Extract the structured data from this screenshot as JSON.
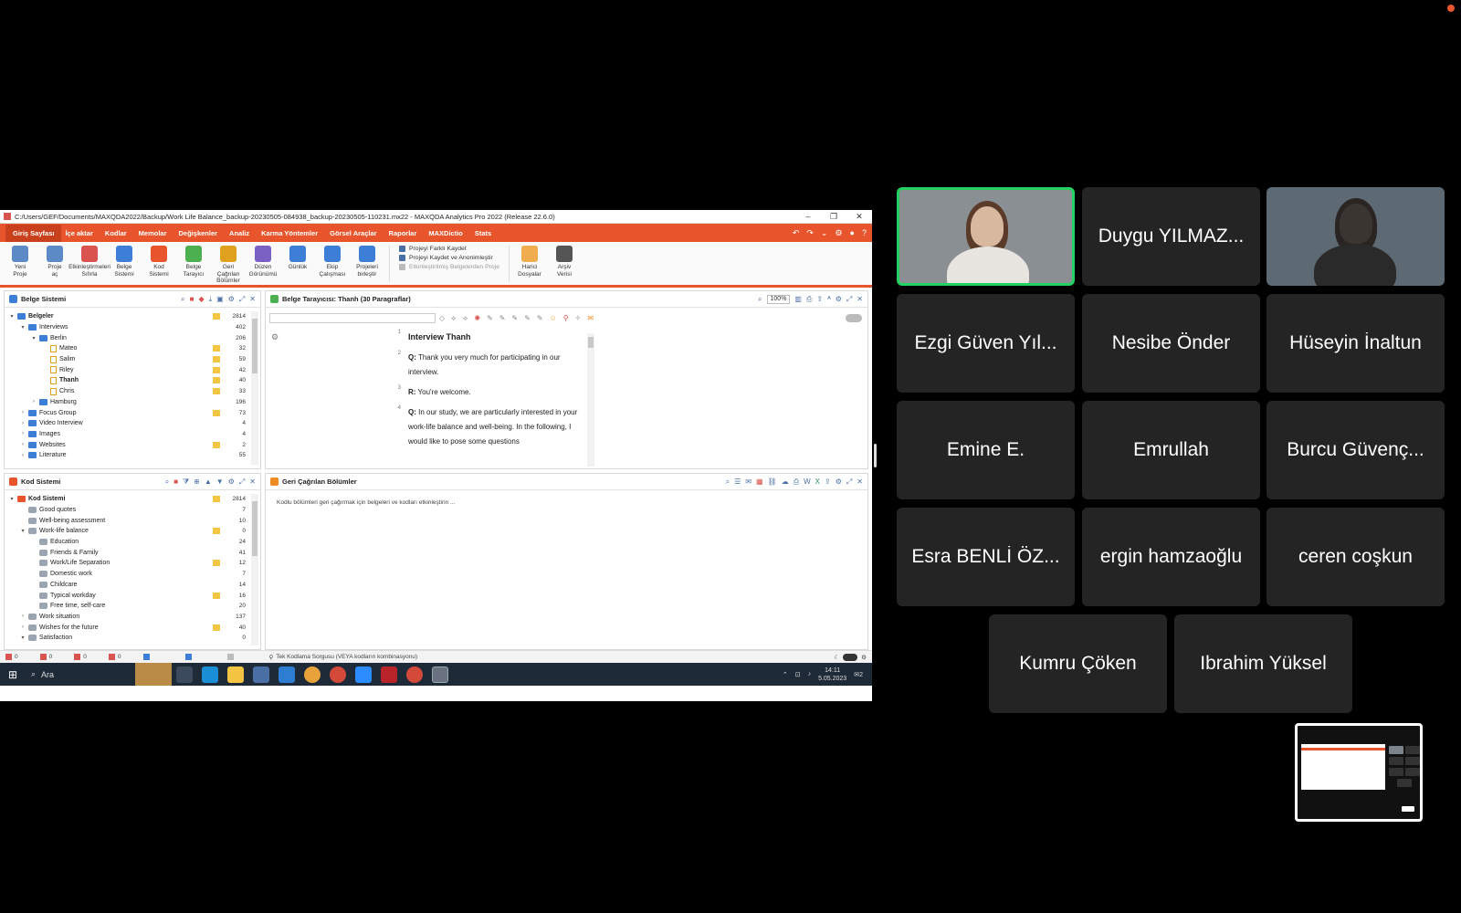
{
  "window": {
    "title": "C:/Users/GEF/Documents/MAXQDA2022/Backup/Work Life Balance_backup-20230505-084938_backup-20230505-110231.mx22 - MAXQDA Analytics Pro 2022 (Release 22.6.0)"
  },
  "menu": [
    "Giriş Sayfası",
    "İçe aktar",
    "Kodlar",
    "Memolar",
    "Değişkenler",
    "Analiz",
    "Karma Yöntemler",
    "Görsel Araçlar",
    "Raporlar",
    "MAXDictio",
    "Stats"
  ],
  "ribbon": {
    "buttons": [
      {
        "label": "Yeni\nProje",
        "color": "#5b8ac7"
      },
      {
        "label": "Proje\naç",
        "color": "#5b8ac7"
      },
      {
        "label": "Etkinleştirmeleri\nSıfırla",
        "color": "#d9534f"
      },
      {
        "label": "Belge\nSistemi",
        "color": "#3d7fd6"
      },
      {
        "label": "Kod\nSistemi",
        "color": "#e8552c"
      },
      {
        "label": "Belge\nTarayıcı",
        "color": "#4caf50"
      },
      {
        "label": "Geri Çağrılan\nBölümler",
        "color": "#e0a020"
      },
      {
        "label": "Düzen\nGörünümü",
        "color": "#7b61c4"
      },
      {
        "label": "Günlük",
        "color": "#3d7fd6"
      },
      {
        "label": "Ekip\nÇalışması",
        "color": "#3d7fd6"
      },
      {
        "label": "Projeleri\nbirleştir",
        "color": "#3d7fd6"
      }
    ],
    "list": [
      "Projeyi Farklı Kaydet",
      "Projeyi Kaydet ve Anonimleştir",
      "Etkinleştirilmiş Belgelerden Proje"
    ],
    "buttons2": [
      {
        "label": "Harici\nDosyalar",
        "color": "#f0ad4e"
      },
      {
        "label": "Arşiv\nVerisi",
        "color": "#555555"
      }
    ]
  },
  "document_system": {
    "title": "Belge Sistemi",
    "rows": [
      {
        "name": "Belgeler",
        "count": "2814",
        "level": 0,
        "type": "folder",
        "arrow": "▾",
        "bold": true
      },
      {
        "name": "Interviews",
        "count": "402",
        "level": 1,
        "type": "folder",
        "arrow": "▾"
      },
      {
        "name": "Berlin",
        "count": "206",
        "level": 2,
        "type": "folder",
        "arrow": "▾"
      },
      {
        "name": "Mateo",
        "count": "32",
        "level": 3,
        "type": "doc",
        "arrow": ""
      },
      {
        "name": "Salim",
        "count": "59",
        "level": 3,
        "type": "doc",
        "arrow": ""
      },
      {
        "name": "Riley",
        "count": "42",
        "level": 3,
        "type": "doc",
        "arrow": ""
      },
      {
        "name": "Thanh",
        "count": "40",
        "level": 3,
        "type": "doc",
        "arrow": "",
        "bold": true
      },
      {
        "name": "Chris",
        "count": "33",
        "level": 3,
        "type": "doc",
        "arrow": ""
      },
      {
        "name": "Hamburg",
        "count": "196",
        "level": 2,
        "type": "folder",
        "arrow": "›"
      },
      {
        "name": "Focus Group",
        "count": "73",
        "level": 1,
        "type": "folder",
        "arrow": "›"
      },
      {
        "name": "Video Interview",
        "count": "4",
        "level": 1,
        "type": "folder",
        "arrow": "›"
      },
      {
        "name": "Images",
        "count": "4",
        "level": 1,
        "type": "folder",
        "arrow": "›"
      },
      {
        "name": "Websites",
        "count": "2",
        "level": 1,
        "type": "folder",
        "arrow": "›"
      },
      {
        "name": "Literature",
        "count": "55",
        "level": 1,
        "type": "folder",
        "arrow": "›"
      }
    ]
  },
  "document_browser": {
    "title": "Belge Tarayıcısı: Thanh   (30 Paragraflar)",
    "zoom": "100%",
    "paragraphs": [
      {
        "n": "1",
        "speaker": "",
        "text": "Interview Thanh",
        "heading": true
      },
      {
        "n": "2",
        "speaker": "Q:",
        "text": "Thank you very much for participating in our interview."
      },
      {
        "n": "3",
        "speaker": "R:",
        "text": "You're welcome."
      },
      {
        "n": "4",
        "speaker": "Q:",
        "text": "In our study, we are particularly interested in your work-life balance and well-being. In the following, I would like to pose some questions"
      }
    ]
  },
  "code_system": {
    "title": "Kod Sistemi",
    "rows": [
      {
        "name": "Kod Sistemi",
        "count": "2814",
        "level": 0,
        "type": "root",
        "arrow": "▾",
        "bold": true
      },
      {
        "name": "Good quotes",
        "count": "7",
        "level": 1,
        "type": "code",
        "arrow": ""
      },
      {
        "name": "Well-being assessment",
        "count": "10",
        "level": 1,
        "type": "code",
        "arrow": ""
      },
      {
        "name": "Work-life balance",
        "count": "0",
        "level": 1,
        "type": "code",
        "arrow": "▾"
      },
      {
        "name": "Education",
        "count": "24",
        "level": 2,
        "type": "code",
        "arrow": ""
      },
      {
        "name": "Friends & Family",
        "count": "41",
        "level": 2,
        "type": "code",
        "arrow": ""
      },
      {
        "name": "Work/Life Separation",
        "count": "12",
        "level": 2,
        "type": "code",
        "arrow": ""
      },
      {
        "name": "Domestic work",
        "count": "7",
        "level": 2,
        "type": "code",
        "arrow": ""
      },
      {
        "name": "Childcare",
        "count": "14",
        "level": 2,
        "type": "code",
        "arrow": ""
      },
      {
        "name": "Typical workday",
        "count": "16",
        "level": 2,
        "type": "code",
        "arrow": ""
      },
      {
        "name": "Free time, self-care",
        "count": "20",
        "level": 2,
        "type": "code",
        "arrow": ""
      },
      {
        "name": "Work situation",
        "count": "137",
        "level": 1,
        "type": "code",
        "arrow": "›"
      },
      {
        "name": "Wishes for the future",
        "count": "40",
        "level": 1,
        "type": "code",
        "arrow": "›"
      },
      {
        "name": "Satisfaction",
        "count": "0",
        "level": 1,
        "type": "code",
        "arrow": "▾"
      }
    ]
  },
  "retrieved": {
    "title": "Geri Çağrılan Bölümler",
    "hint": "Kodlu bölümleri geri çağırmak için belgeleri ve kodları etkinleştirin ..."
  },
  "statusbar": {
    "counts": [
      "0",
      "0",
      "0",
      "0"
    ],
    "query": "Tek Kodlama Sorgusu (VEYA kodların kombinasyonu)"
  },
  "taskbar": {
    "search": "Ara",
    "time": "14:11",
    "date": "5.05.2023",
    "notifications": "2"
  },
  "participants": [
    {
      "name": "",
      "video": true,
      "active": true
    },
    {
      "name": "Duygu YILMAZ...",
      "video": false
    },
    {
      "name": "",
      "video": true
    },
    {
      "name": "Ezgi Güven Yıl...",
      "video": false
    },
    {
      "name": "Nesibe Önder",
      "video": false
    },
    {
      "name": "Hüseyin İnaltun",
      "video": false
    },
    {
      "name": "Emine E.",
      "video": false
    },
    {
      "name": "Emrullah",
      "video": false
    },
    {
      "name": "Burcu Güvenç...",
      "video": false
    },
    {
      "name": "Esra BENLİ ÖZ...",
      "video": false
    },
    {
      "name": "ergin hamzaoğlu",
      "video": false
    },
    {
      "name": "ceren coşkun",
      "video": false
    },
    {
      "name": "Kumru Çöken",
      "video": false
    },
    {
      "name": "Ibrahim Yüksel",
      "video": false
    }
  ]
}
